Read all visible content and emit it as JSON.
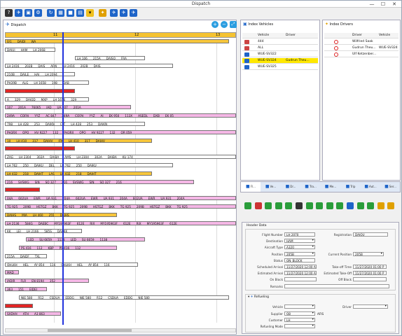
{
  "window": {
    "title": "Dispatch",
    "minimize": "—",
    "maximize": "☐",
    "close": "✕"
  },
  "colors": {
    "yellow": "#f7c63b",
    "pink": "#f5b7e6",
    "red": "#e22525",
    "white": "#ffffff",
    "blueline": "#2233dd",
    "tabbar": "#dfe8f5"
  },
  "panels": {
    "dispatch_title": "Dispatch",
    "vehicles_title": "Index Vehicles",
    "drivers_title": "Index Drivers"
  },
  "timeline": {
    "hours": [
      "11",
      "12",
      "13"
    ]
  },
  "vehicles": {
    "columns": [
      "Vehicle",
      "Driver"
    ],
    "rows": [
      {
        "vehicle": "444",
        "driver": ""
      },
      {
        "vehicle": "ALL",
        "driver": ""
      },
      {
        "vehicle": "WUE-SV322",
        "driver": ""
      },
      {
        "vehicle": "WUE-SV324",
        "driver": "Gudrun Theu..."
      },
      {
        "vehicle": "WUE-SV325",
        "driver": ""
      }
    ]
  },
  "drivers": {
    "columns": [
      "Driver",
      "Vehicle"
    ],
    "rows": [
      {
        "driver": "Wilfried Saak",
        "vehicle": ""
      },
      {
        "driver": "Gudrun Theu...",
        "vehicle": "WUE-SV324"
      },
      {
        "driver": "Ulf Ketzenber...",
        "vehicle": ""
      }
    ]
  },
  "tabs": [
    "Fl...",
    "Ve...",
    "Dr...",
    "Tra...",
    "Me...",
    "Trip",
    "Aut...",
    "Ser..."
  ],
  "form": {
    "section_header": "Header Data",
    "flight_number_label": "Flight Number",
    "flight_number": "LH 2070",
    "registration_label": "Registration",
    "registration": "DAIQU",
    "destination_label": "Destination",
    "destination": "HAM",
    "aircraft_type_label": "Aircraft Type",
    "aircraft_type": "A320",
    "position_label": "Position",
    "position": "205B",
    "current_position_label": "Current Position",
    "current_position": "205B",
    "status_label": "Status",
    "status": "ON_BLOCK",
    "sched_arrival_label": "Scheduled Arrival",
    "sched_arrival": "11/27/2020 12:00 A",
    "takeoff_time_label": "Take-off Time",
    "takeoff_time": "11/27/2020 01:00 P",
    "est_arrival_label": "Estimated Arrival",
    "est_arrival": "11/27/2020 12:00 A",
    "est_takeoff_label": "Estimated Take-Off",
    "est_takeoff": "11/27/2020 01:00 P",
    "on_block_label": "On Block",
    "on_block": "",
    "off_block_label": "Off Block",
    "off_block": "",
    "remarks_label": "Remarks",
    "remarks": "",
    "refueling_header": "Refueling",
    "vehicle_label": "Vehicle",
    "vehicle": "",
    "driver_label": "Driver",
    "driver": "",
    "supplier_label": "Supplier",
    "supplier": "Q8",
    "supplier_extra": "AFIS",
    "customer_label": "Customer",
    "customer": "LH",
    "refueling_mode_label": "Refueling Mode",
    "refueling_mode": ""
  },
  "gantt_rows": [
    {
      "color": "yellow",
      "cells": [
        "0/1",
        "DAIDI",
        "WA"
      ]
    },
    {
      "color": "white",
      "cells": [
        "DAIUI",
        "HAM",
        "LH 2068"
      ]
    },
    {
      "color": "white",
      "cells": [
        "LH 106",
        "215A",
        "DAISQ",
        "FRA"
      ]
    },
    {
      "color": "white",
      "cells": [
        "LH 2416",
        "202B",
        "DAIS",
        "ARN",
        "LH 2416",
        "202B",
        "DAIS"
      ]
    },
    {
      "color": "white",
      "cells": [
        "210B",
        "DAILE",
        "HAJ",
        "LH 2094"
      ]
    },
    {
      "color": "white",
      "cells": [
        "PH39B",
        "ALG",
        "LH 1658",
        "198",
        "DAB"
      ]
    },
    {
      "color": "red",
      "cells": [
        "",
        "",
        "",
        ""
      ]
    },
    {
      "color": "white",
      "cells": [
        "A",
        "329",
        "DAIQD",
        "MXP",
        "LH 1656",
        "329"
      ]
    },
    {
      "color": "pink",
      "cells": [
        "107",
        "201A",
        "76065",
        "IAD",
        "UA 107",
        "201A"
      ]
    },
    {
      "color": "pink",
      "cells": [
        "249A",
        "COFAJ",
        "YYZ",
        "AC 847",
        "249A",
        "COFAJ",
        "YYZ",
        "AI",
        "EK 950",
        "113X",
        "ASEDL",
        "DXB",
        "EK 05"
      ]
    },
    {
      "color": "white",
      "cells": [
        "798",
        "LH 428",
        "253",
        "DAIKN",
        "CLT",
        "LH 428",
        "253",
        "DAIKN"
      ]
    },
    {
      "color": "pink",
      "cells": [
        "PH3RX",
        "OPO",
        "HV 9227",
        "132",
        "PH3RX",
        "OPO",
        "HV 9227",
        "132",
        "QR 059"
      ]
    },
    {
      "color": "yellow",
      "cells": [
        "10",
        "LH 410",
        "317",
        "DAIHV",
        "JFK",
        "LH 410",
        "317",
        "DAIHV"
      ]
    },
    {
      "color": "red",
      "cells": [
        "",
        "",
        "",
        ""
      ]
    },
    {
      "color": "white",
      "cells": [
        "ZAG",
        "LH 2304",
        "302A",
        "DAIBA",
        "AMS",
        "LH 2304",
        "302A",
        "DAIBA",
        "KU 174"
      ]
    },
    {
      "color": "white",
      "cells": [
        "LH 762",
        "250",
        "DAIKU",
        "DEL",
        "LH 762",
        "250",
        "DAIKU"
      ]
    },
    {
      "color": "yellow",
      "cells": [
        "LH 432",
        "218",
        "DAIHT",
        "LAS",
        "LH 432",
        "218",
        "DAIHT"
      ]
    },
    {
      "color": "pink",
      "cells": [
        "216",
        "SVSWG",
        "SIN",
        "SQ 327",
        "216",
        "SVSWG",
        "SIN",
        "SQ 327",
        "216"
      ]
    },
    {
      "color": "red",
      "cells": [
        "",
        "",
        ""
      ]
    },
    {
      "color": "pink",
      "cells": [
        "04A",
        "602UA",
        "EWR",
        "UA 931",
        "204A",
        "602UA",
        "EWR",
        "UA 931",
        "204A",
        "602UA",
        "EWR",
        "UA 931",
        "204A"
      ]
    },
    {
      "color": "pink",
      "cells": [
        "TG 925",
        "209B",
        "HSTGZ",
        "BKK",
        "TG 925",
        "209B",
        "HSTGZ",
        "BKK",
        "TG 925",
        "209B",
        "HSTGZ",
        "BKK",
        "TG 925"
      ]
    },
    {
      "color": "yellow",
      "cells": [
        "DAIHS",
        "MIA",
        "LH 460",
        "255",
        "DAIHS"
      ]
    },
    {
      "color": "pink",
      "cells": [
        "LH 2136",
        "584G",
        "DAEBC",
        "MY195963F",
        "612E",
        "RIX",
        "MY195963F",
        "612E",
        "RIX",
        "MY195963F",
        "612E"
      ]
    },
    {
      "color": "white",
      "cells": [
        "KK",
        "LEJ",
        "LH 2166",
        "585S",
        "DACKK"
      ]
    },
    {
      "color": "pink",
      "cells": [
        "LED",
        "SU 6659",
        "1138",
        "LED",
        "SU 6659",
        "1138"
      ]
    },
    {
      "color": "pink",
      "cells": [
        "PS 416",
        "112",
        "KBP",
        "PS 416",
        "112"
      ]
    },
    {
      "color": "white",
      "cells": [
        "215A",
        "DAIDF",
        "TXL"
      ]
    },
    {
      "color": "white",
      "cells": [
        "OHLKH",
        "HEL",
        "AY 854",
        "116",
        "OHLKH",
        "HEL",
        "AY 854",
        "116"
      ]
    },
    {
      "color": "pink",
      "cells": [
        "MAD",
        "UX"
      ]
    },
    {
      "color": "pink",
      "cells": [
        "IADJR",
        "FLR",
        "EN 8194",
        "352"
      ]
    },
    {
      "color": "pink",
      "cells": [
        "363",
        "151",
        "EIDEJ"
      ]
    },
    {
      "color": "white",
      "cells": [
        "NJE 580",
        "R12",
        "CSDUA",
        "EDDG",
        "NJE 580",
        "R12",
        "CSDUA",
        "EDDG",
        "NJE 580"
      ]
    },
    {
      "color": "red",
      "cells": [
        "",
        "",
        ""
      ]
    },
    {
      "color": "pink",
      "cells": [
        "SXDVH",
        "ATH",
        "A3 863"
      ]
    }
  ]
}
